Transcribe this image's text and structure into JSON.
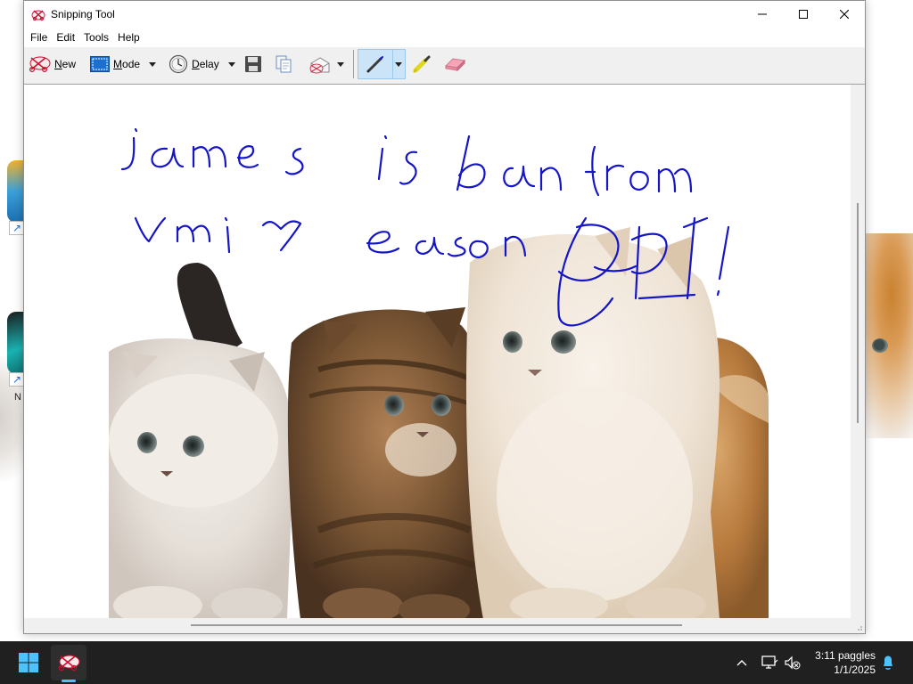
{
  "window": {
    "title": "Snipping Tool"
  },
  "menu": [
    "File",
    "Edit",
    "Tools",
    "Help"
  ],
  "toolbar": {
    "new_label": "New",
    "mode_label": "Mode",
    "delay_label": "Delay"
  },
  "snip": {
    "handwriting_line1": "james is ban from",
    "handwriting_line2": "vmi r eason BRI!"
  },
  "desktop": {
    "icon_label": "N"
  },
  "taskbar": {
    "time": "3:11 paggles",
    "date": "1/1/2025"
  },
  "colors": {
    "ink": "#1515c8",
    "pen_selected": "#cce4f7",
    "taskbar": "#202020",
    "accent": "#0078d4"
  }
}
